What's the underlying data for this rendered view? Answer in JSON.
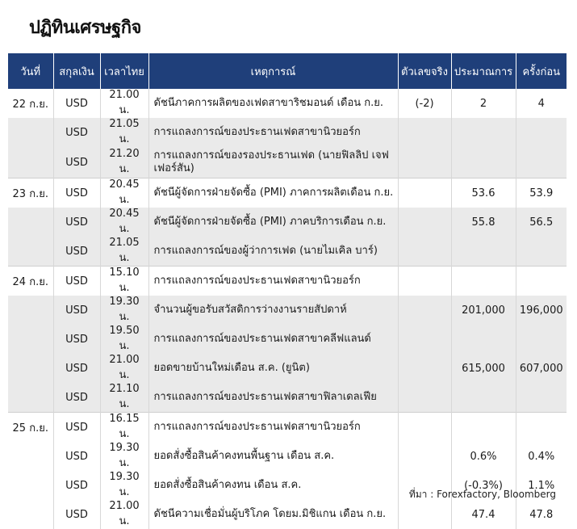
{
  "title": "ปฏิทินเศรษฐกิจ",
  "headers": {
    "date": "วันที่",
    "currency": "สกุลเงิน",
    "time": "เวลาไทย",
    "event": "เหตุการณ์",
    "actual": "ตัวเลขจริง",
    "forecast": "ประมาณการ",
    "previous": "ครั้งก่อน"
  },
  "rows": [
    {
      "date": "22 ก.ย.",
      "currency": "USD",
      "time": "21.00 น.",
      "event": "ดัชนีภาคการผลิตของเฟดสาขาริชมอนด์ เดือน ก.ย.",
      "actual": "(-2)",
      "forecast": "2",
      "previous": "4"
    },
    {
      "date": "",
      "currency": "USD",
      "time": "21.05 น.",
      "event": "การแถลงการณ์ของประธานเฟดสาขานิวยอร์ก",
      "actual": "",
      "forecast": "",
      "previous": ""
    },
    {
      "date": "",
      "currency": "USD",
      "time": "21.20 น.",
      "event": "การแถลงการณ์ของรองประธานเฟด (นายฟิลลิป เจฟเฟอร์สัน)",
      "actual": "",
      "forecast": "",
      "previous": ""
    },
    {
      "date": "23 ก.ย.",
      "currency": "USD",
      "time": "20.45 น.",
      "event": "ดัชนีผู้จัดการฝ่ายจัดซื้อ (PMI) ภาคการผลิตเดือน ก.ย.",
      "actual": "",
      "forecast": "53.6",
      "previous": "53.9"
    },
    {
      "date": "",
      "currency": "USD",
      "time": "20.45 น.",
      "event": "ดัชนีผู้จัดการฝ่ายจัดซื้อ (PMI) ภาคบริการเดือน ก.ย.",
      "actual": "",
      "forecast": "55.8",
      "previous": "56.5"
    },
    {
      "date": "",
      "currency": "USD",
      "time": "21.05 น.",
      "event": "การแถลงการณ์ของผู้ว่าการเฟด (นายไมเคิล บาร์)",
      "actual": "",
      "forecast": "",
      "previous": ""
    },
    {
      "date": "24 ก.ย.",
      "currency": "USD",
      "time": "15.10 น.",
      "event": "การแถลงการณ์ของประธานเฟดสาขานิวยอร์ก",
      "actual": "",
      "forecast": "",
      "previous": ""
    },
    {
      "date": "",
      "currency": "USD",
      "time": "19.30 น.",
      "event": "จำนวนผู้ขอรับสวัสดิการว่างงานรายสัปดาห์",
      "actual": "",
      "forecast": "201,000",
      "previous": "196,000"
    },
    {
      "date": "",
      "currency": "USD",
      "time": "19.50 น.",
      "event": "การแถลงการณ์ของประธานเฟดสาขาคลีฟแลนด์",
      "actual": "",
      "forecast": "",
      "previous": ""
    },
    {
      "date": "",
      "currency": "USD",
      "time": "21.00 น.",
      "event": "ยอดขายบ้านใหม่เดือน ส.ค. (ยูนิต)",
      "actual": "",
      "forecast": "615,000",
      "previous": "607,000"
    },
    {
      "date": "",
      "currency": "USD",
      "time": "21.10 น.",
      "event": "การแถลงการณ์ของประธานเฟดสาขาฟิลาเดลเฟีย",
      "actual": "",
      "forecast": "",
      "previous": ""
    },
    {
      "date": "25 ก.ย.",
      "currency": "USD",
      "time": "16.15 น.",
      "event": "การแถลงการณ์ของประธานเฟดสาขานิวยอร์ก",
      "actual": "",
      "forecast": "",
      "previous": ""
    },
    {
      "date": "",
      "currency": "USD",
      "time": "19.30 น.",
      "event": "ยอดสั่งซื้อสินค้าคงทนพื้นฐาน เดือน ส.ค.",
      "actual": "",
      "forecast": "0.6%",
      "previous": "0.4%"
    },
    {
      "date": "",
      "currency": "USD",
      "time": "19.30 น.",
      "event": "ยอดสั่งซื้อสินค้าคงทน เดือน ส.ค.",
      "actual": "",
      "forecast": "(-0.3%)",
      "previous": "1.1%"
    },
    {
      "date": "",
      "currency": "USD",
      "time": "21.00 น.",
      "event": "ดัชนีความเชื่อมั่นผู้บริโภค โดยม.มิชิแกน เดือน ก.ย.",
      "actual": "",
      "forecast": "47.4",
      "previous": "47.8"
    }
  ],
  "source": "ที่มา : Forexfactory, Bloomberg",
  "colors": {
    "header_bg": "#1f3f7a",
    "shade": "#eaeaea"
  }
}
